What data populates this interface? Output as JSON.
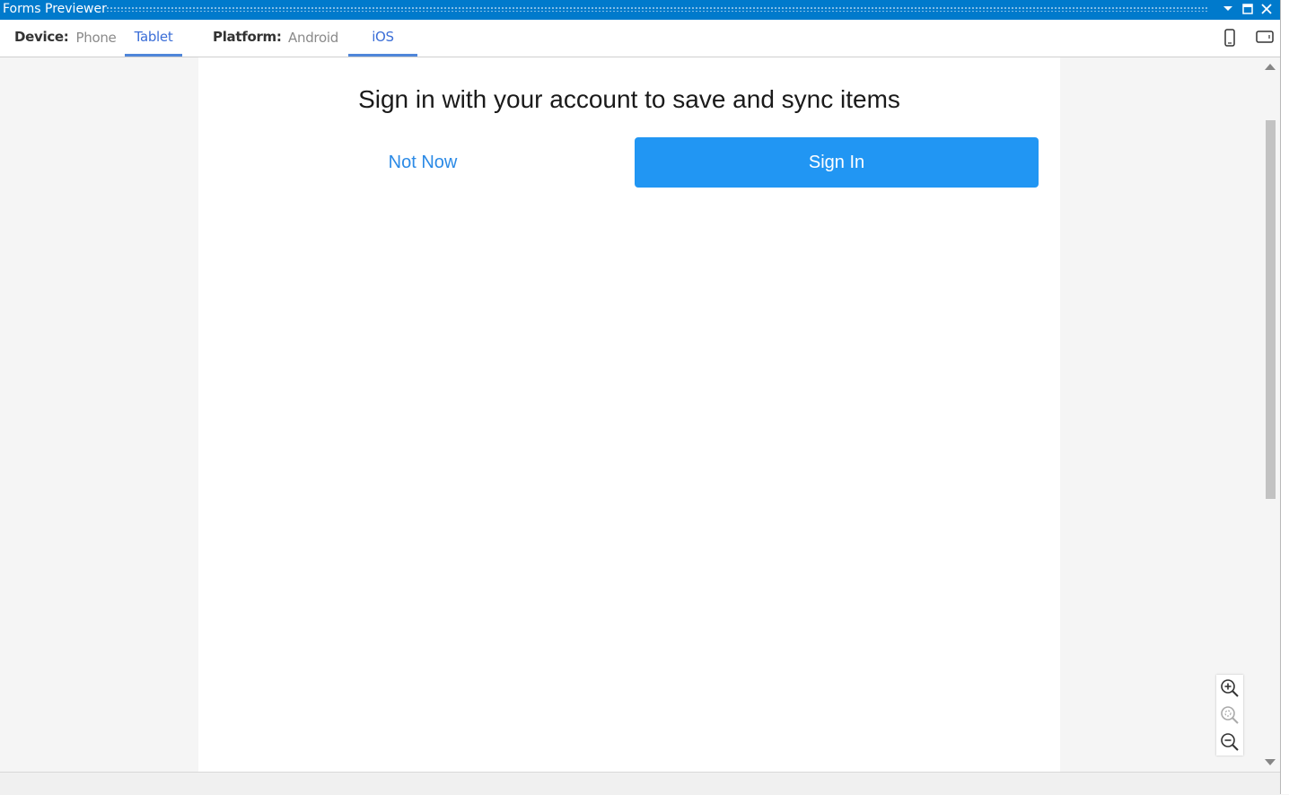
{
  "window": {
    "title": "Forms Previewer"
  },
  "toolbar": {
    "device_label": "Device:",
    "device_tabs": [
      "Phone",
      "Tablet"
    ],
    "device_selected": "Tablet",
    "platform_label": "Platform:",
    "platform_tabs": [
      "Android",
      "iOS"
    ],
    "platform_selected": "iOS"
  },
  "preview": {
    "heading": "Sign in with your account to save and sync items",
    "not_now_label": "Not Now",
    "sign_in_label": "Sign In"
  },
  "colors": {
    "titlebar": "#007acc",
    "tab_active": "#3b6ed7",
    "link_blue": "#2b8ae6",
    "button_blue": "#2196f3"
  },
  "icons": [
    "dropdown-icon",
    "maximize-icon",
    "close-icon",
    "phone-portrait-icon",
    "tablet-landscape-icon",
    "zoom-in-icon",
    "zoom-reset-icon",
    "zoom-out-icon"
  ]
}
